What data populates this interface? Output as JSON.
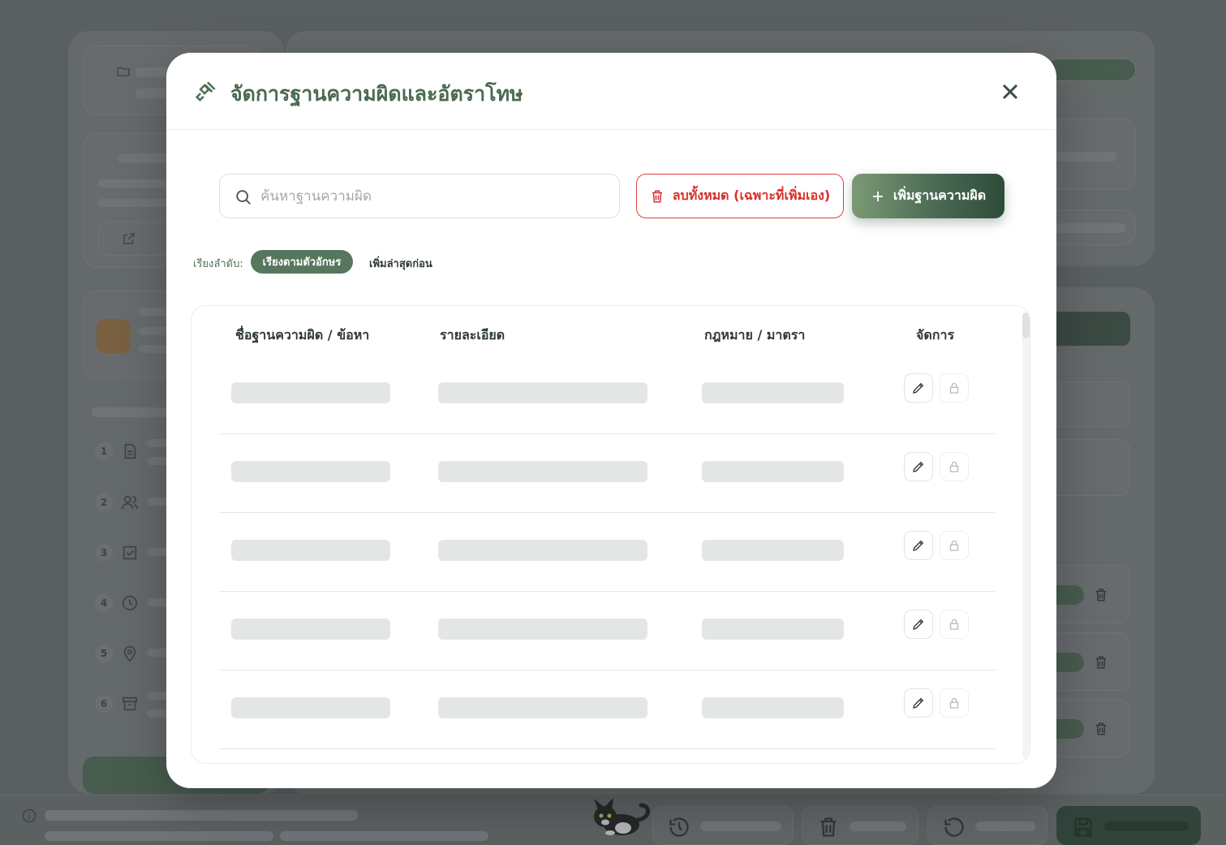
{
  "modal": {
    "title": "จัดการฐานความผิดและอัตราโทษ",
    "icon": "gavel-icon",
    "close_icon": "close-icon"
  },
  "search": {
    "placeholder": "ค้นหาฐานความผิด",
    "value": "",
    "icon": "search-icon"
  },
  "actions": {
    "delete_all_label": "ลบทั้งหมด (เฉพาะที่เพิ่มเอง)",
    "add_label": "เพิ่มฐานความผิด",
    "delete_color": "#d9302c",
    "add_color": "#4a6a53"
  },
  "sort": {
    "label": "เรียงลำดับ:",
    "options": [
      "เรียงตามตัวอักษร",
      "เพิ่มล่าสุดก่อน"
    ],
    "active": "เรียงตามตัวอักษร"
  },
  "table": {
    "headers": [
      "ชื่อฐานความผิด / ข้อหา",
      "รายละเอียด",
      "กฎหมาย / มาตรา",
      "จัดการ"
    ],
    "row_count": 5,
    "row_state": "loading",
    "row_actions": [
      "pencil-icon",
      "lock-icon"
    ]
  },
  "brand_color": "#4a6a52"
}
